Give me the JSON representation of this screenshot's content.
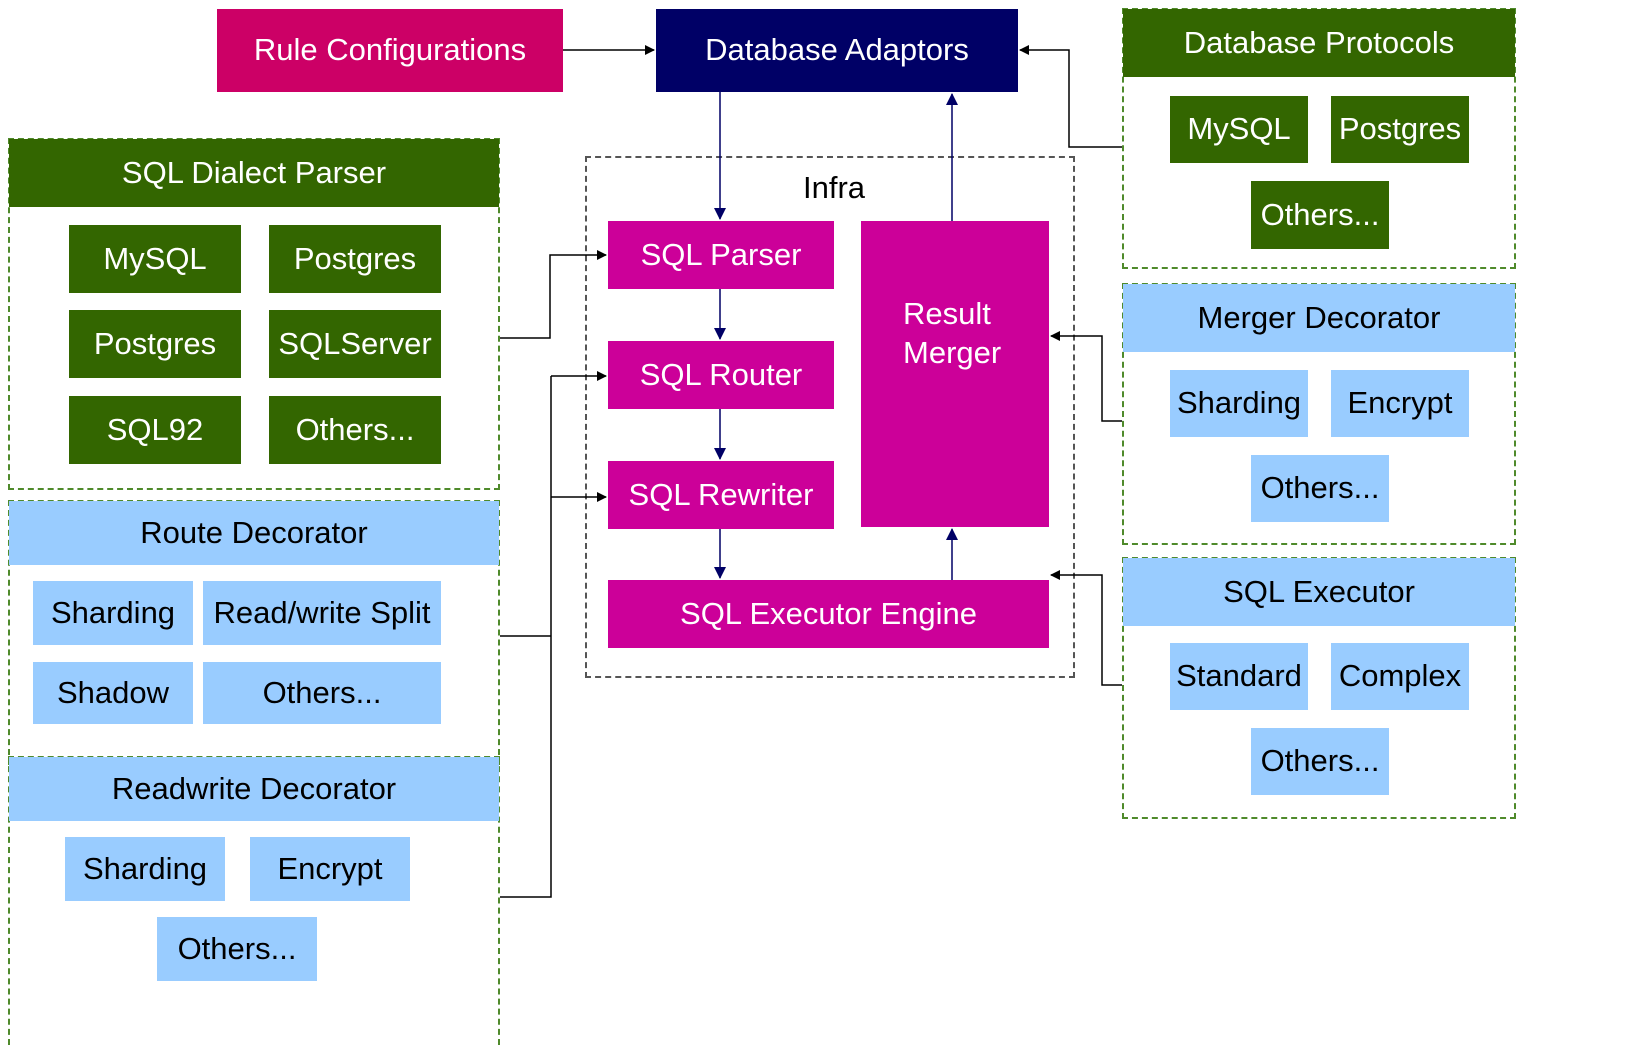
{
  "top": {
    "rule_configurations": "Rule Configurations",
    "database_adaptors": "Database Adaptors"
  },
  "infra": {
    "title": "Infra",
    "sql_parser": "SQL Parser",
    "sql_router": "SQL Router",
    "sql_rewriter": "SQL Rewriter",
    "result_merger": "Result\nMerger",
    "sql_executor_engine": "SQL Executor Engine"
  },
  "left": {
    "sql_dialect_parser": {
      "title": "SQL Dialect Parser",
      "items": [
        "MySQL",
        "Postgres",
        "Postgres",
        "SQLServer",
        "SQL92",
        "Others..."
      ]
    },
    "route_decorator": {
      "title": "Route Decorator",
      "items": [
        "Sharding",
        "Read/write Split",
        "Shadow",
        "Others..."
      ]
    },
    "readwrite_decorator": {
      "title": "Readwrite Decorator",
      "items": [
        "Sharding",
        "Encrypt",
        "Others..."
      ]
    }
  },
  "right": {
    "database_protocols": {
      "title": "Database Protocols",
      "items": [
        "MySQL",
        "Postgres",
        "Others..."
      ]
    },
    "merger_decorator": {
      "title": "Merger Decorator",
      "items": [
        "Sharding",
        "Encrypt",
        "Others..."
      ]
    },
    "sql_executor": {
      "title": "SQL Executor",
      "items": [
        "Standard",
        "Complex",
        "Others..."
      ]
    }
  },
  "colors": {
    "rule_config": "#cc0066",
    "adaptor": "#000066",
    "infra_block": "#cc0099",
    "green": "#336600",
    "blue": "#99ccff"
  }
}
